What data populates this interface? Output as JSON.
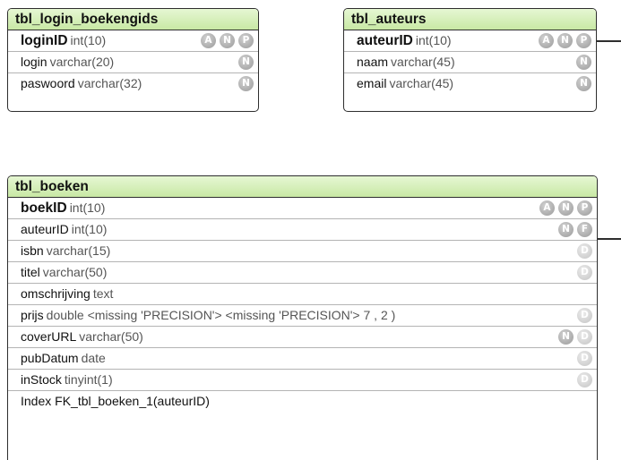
{
  "tables": {
    "login": {
      "title": "tbl_login_boekengids",
      "columns": [
        {
          "name": "loginID",
          "type": "int(10)",
          "badges": [
            "A",
            "N",
            "P"
          ]
        },
        {
          "name": "login",
          "type": "varchar(20)",
          "badges": [
            "N"
          ]
        },
        {
          "name": "paswoord",
          "type": "varchar(32)",
          "badges": [
            "N"
          ]
        }
      ]
    },
    "auteurs": {
      "title": "tbl_auteurs",
      "columns": [
        {
          "name": "auteurID",
          "type": "int(10)",
          "badges": [
            "A",
            "N",
            "P"
          ]
        },
        {
          "name": "naam",
          "type": "varchar(45)",
          "badges": [
            "N"
          ]
        },
        {
          "name": "email",
          "type": "varchar(45)",
          "badges": [
            "N"
          ]
        }
      ]
    },
    "boeken": {
      "title": "tbl_boeken",
      "columns": [
        {
          "name": "boekID",
          "type": "int(10)",
          "badges": [
            "A",
            "N",
            "P"
          ]
        },
        {
          "name": "auteurID",
          "type": "int(10)",
          "badges": [
            "N",
            "F"
          ]
        },
        {
          "name": "isbn",
          "type": "varchar(15)",
          "badges": [
            "D"
          ]
        },
        {
          "name": "titel",
          "type": "varchar(50)",
          "badges": [
            "D"
          ]
        },
        {
          "name": "omschrijving",
          "type": "text",
          "badges": []
        },
        {
          "name": "prijs",
          "type": "double <missing 'PRECISION'> <missing 'PRECISION'> 7 , 2 )",
          "badges": [
            "D"
          ]
        },
        {
          "name": "coverURL",
          "type": "varchar(50)",
          "badges": [
            "N",
            "D"
          ]
        },
        {
          "name": "pubDatum",
          "type": "date",
          "badges": [
            "D"
          ]
        },
        {
          "name": "inStock",
          "type": "tinyint(1)",
          "badges": [
            "D"
          ]
        }
      ],
      "index": "Index FK_tbl_boeken_1(auteurID)"
    }
  }
}
